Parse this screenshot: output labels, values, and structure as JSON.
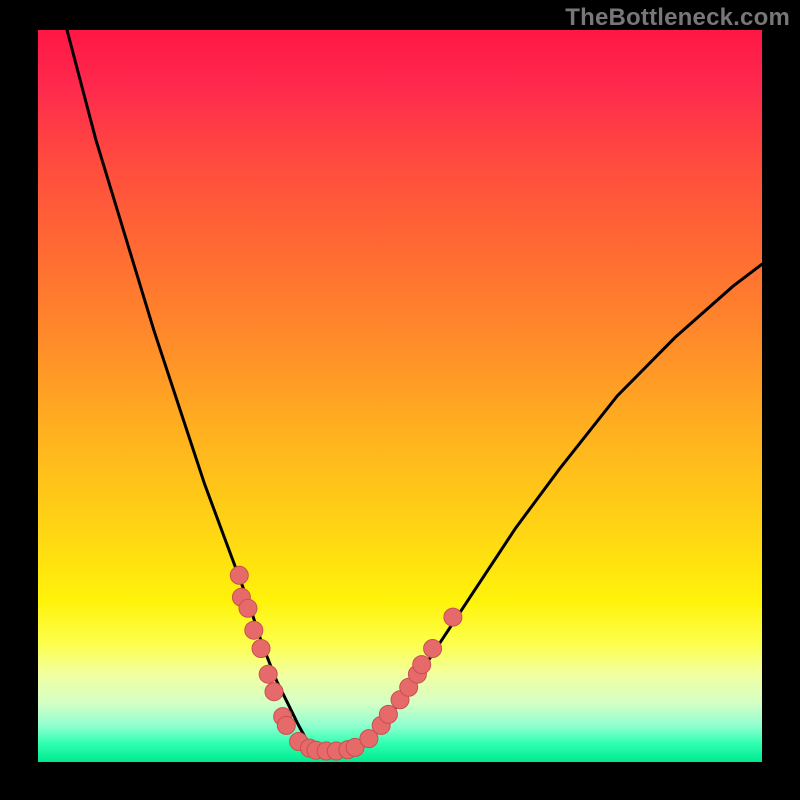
{
  "watermark": "TheBottleneck.com",
  "colors": {
    "curve_stroke": "#000000",
    "dot_fill": "#e66a6a",
    "dot_stroke": "#c94f4f"
  },
  "chart_data": {
    "type": "line",
    "title": "",
    "xlabel": "",
    "ylabel": "",
    "xlim": [
      0,
      100
    ],
    "ylim": [
      0,
      100
    ],
    "series": [
      {
        "name": "curve",
        "x": [
          4,
          8,
          12,
          16,
          20,
          23,
          26,
          29,
          31,
          33,
          34.5,
          36,
          37,
          38,
          39,
          40,
          42,
          44,
          46,
          48,
          52,
          56,
          60,
          66,
          72,
          80,
          88,
          96,
          100
        ],
        "y": [
          100,
          85,
          72,
          59,
          47,
          38,
          30,
          22,
          16,
          11,
          8,
          5,
          3.2,
          2.2,
          1.6,
          1.4,
          1.4,
          1.8,
          3,
          5.5,
          11,
          17,
          23,
          32,
          40,
          50,
          58,
          65,
          68
        ]
      }
    ],
    "scatter": {
      "name": "dots",
      "points": [
        {
          "x": 27.8,
          "y": 25.5
        },
        {
          "x": 28.1,
          "y": 22.5
        },
        {
          "x": 29.0,
          "y": 21.0
        },
        {
          "x": 29.8,
          "y": 18.0
        },
        {
          "x": 30.8,
          "y": 15.5
        },
        {
          "x": 31.8,
          "y": 12.0
        },
        {
          "x": 32.6,
          "y": 9.6
        },
        {
          "x": 33.8,
          "y": 6.2
        },
        {
          "x": 34.3,
          "y": 5.0
        },
        {
          "x": 36.0,
          "y": 2.8
        },
        {
          "x": 37.5,
          "y": 1.9
        },
        {
          "x": 38.4,
          "y": 1.6
        },
        {
          "x": 39.8,
          "y": 1.5
        },
        {
          "x": 41.2,
          "y": 1.5
        },
        {
          "x": 42.8,
          "y": 1.7
        },
        {
          "x": 43.8,
          "y": 2.0
        },
        {
          "x": 45.7,
          "y": 3.2
        },
        {
          "x": 47.4,
          "y": 5.0
        },
        {
          "x": 48.4,
          "y": 6.5
        },
        {
          "x": 50.0,
          "y": 8.5
        },
        {
          "x": 51.2,
          "y": 10.2
        },
        {
          "x": 52.4,
          "y": 12.0
        },
        {
          "x": 53.0,
          "y": 13.3
        },
        {
          "x": 54.5,
          "y": 15.5
        },
        {
          "x": 57.3,
          "y": 19.8
        }
      ]
    }
  }
}
